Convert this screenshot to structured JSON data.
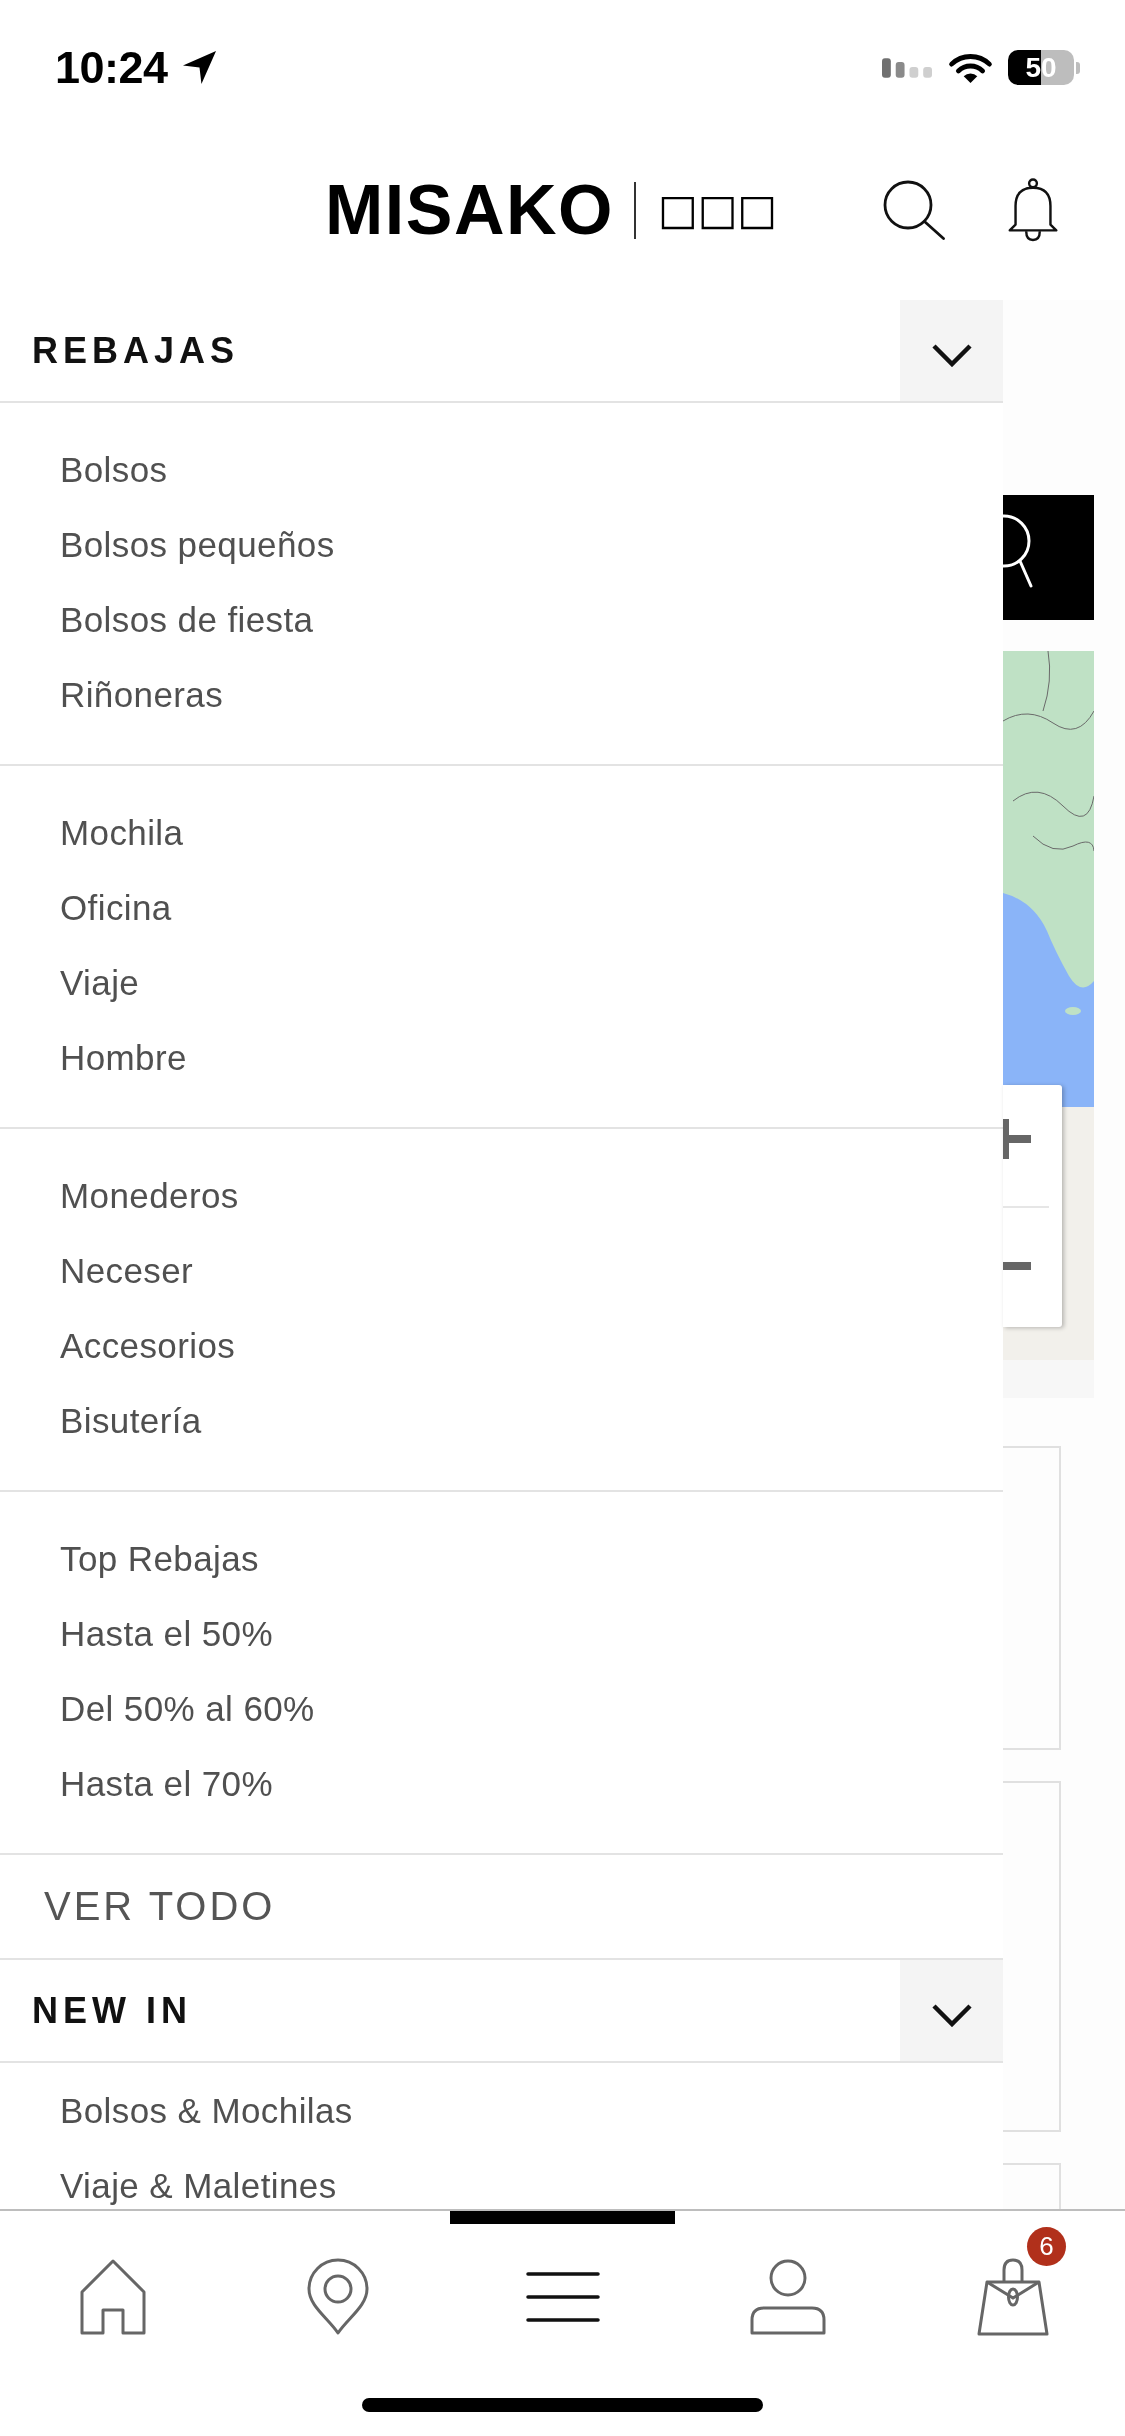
{
  "status_bar": {
    "time": "10:24",
    "battery": "50"
  },
  "header": {
    "logo": "MISAKO",
    "logo_subtitle": "□□□"
  },
  "menu": {
    "sections": [
      {
        "title": "REBAJAS",
        "expanded": true,
        "groups": [
          {
            "items": [
              "Bolsos",
              "Bolsos pequeños",
              "Bolsos de fiesta",
              "Riñoneras"
            ]
          },
          {
            "items": [
              "Mochila",
              "Oficina",
              "Viaje",
              "Hombre"
            ]
          },
          {
            "items": [
              "Monederos",
              "Neceser",
              "Accesorios",
              "Bisutería"
            ]
          },
          {
            "items": [
              "Top Rebajas",
              "Hasta el 50%",
              "Del 50% al 60%",
              "Hasta el 70%"
            ]
          }
        ],
        "view_all": "VER TODO"
      },
      {
        "title": "NEW IN",
        "expanded": true,
        "groups": [
          {
            "items": [
              "Bolsos & Mochilas",
              "Viaje & Maletines"
            ]
          }
        ]
      }
    ]
  },
  "tab_bar": {
    "tabs": [
      {
        "kind": "home",
        "selected": false
      },
      {
        "kind": "location",
        "selected": false
      },
      {
        "kind": "menu",
        "selected": true
      },
      {
        "kind": "account",
        "selected": false
      },
      {
        "kind": "bag",
        "selected": false,
        "badge": "6"
      }
    ]
  }
}
